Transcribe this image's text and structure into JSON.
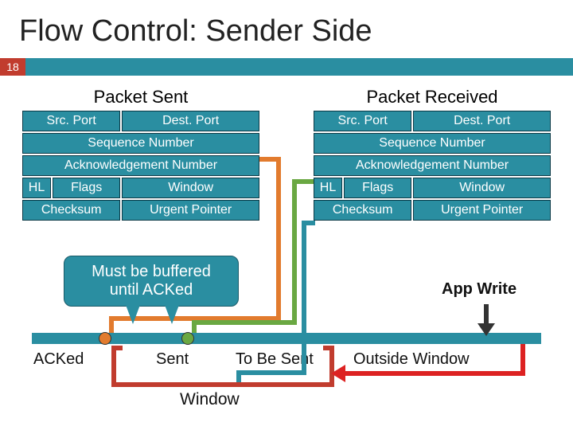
{
  "title": "Flow Control: Sender Side",
  "slide_number": "18",
  "sent_title": "Packet Sent",
  "received_title": "Packet Received",
  "tcp": {
    "src": "Src. Port",
    "dst": "Dest. Port",
    "seq": "Sequence Number",
    "ack": "Acknowledgement Number",
    "hl": "HL",
    "flags": "Flags",
    "win": "Window",
    "chk": "Checksum",
    "urg": "Urgent Pointer"
  },
  "callout": {
    "line1": "Must be buffered",
    "line2": "until ACKed"
  },
  "app_write": "App Write",
  "labels": {
    "acked": "ACKed",
    "sent": "Sent",
    "tobesent": "To Be Sent",
    "outside": "Outside Window"
  },
  "window_label": "Window",
  "colors": {
    "teal": "#2a8ea1",
    "red": "#c13c2e",
    "orange": "#e27b2e",
    "green": "#6aa842"
  }
}
